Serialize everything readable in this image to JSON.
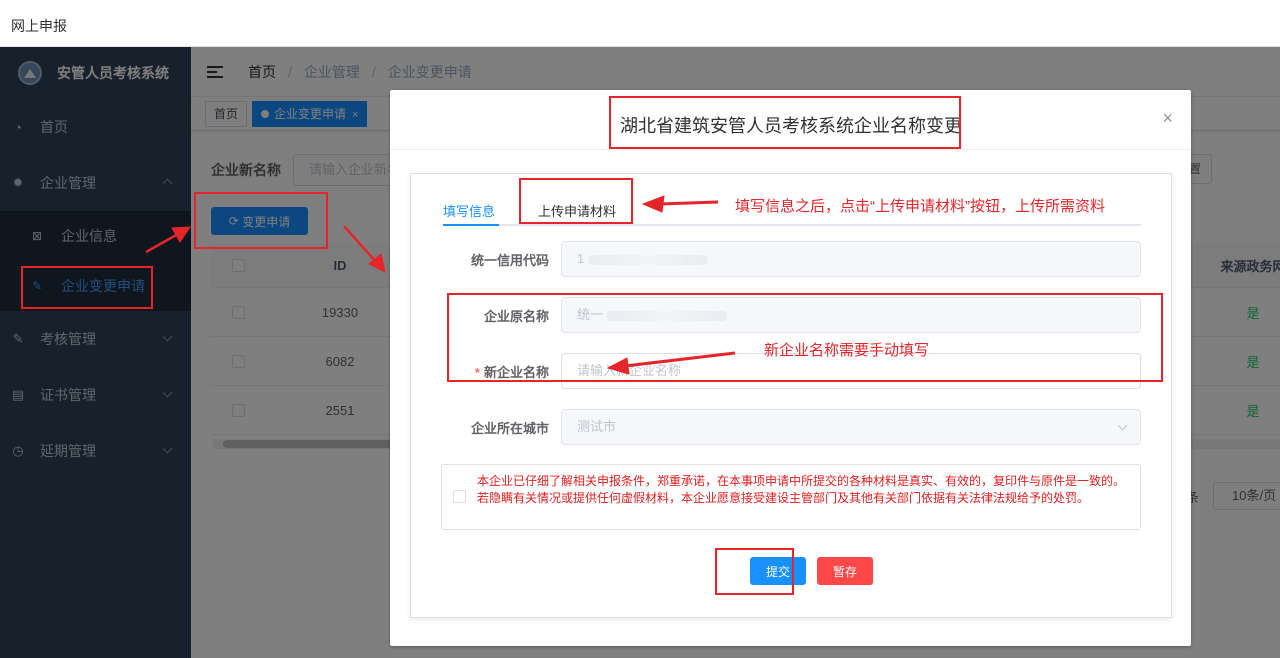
{
  "window": {
    "title": "网上申报"
  },
  "sidebar": {
    "app_name": "安管人员考核系统",
    "items": [
      {
        "label": "首页",
        "icon": "dashboard-icon"
      },
      {
        "label": "企业管理",
        "icon": "gear-icon",
        "expanded": true,
        "children": [
          {
            "label": "企业信息",
            "icon": "id-card-icon"
          },
          {
            "label": "企业变更申请",
            "icon": "edit-icon",
            "active": true
          }
        ]
      },
      {
        "label": "考核管理",
        "icon": "edit-icon"
      },
      {
        "label": "证书管理",
        "icon": "certificate-icon"
      },
      {
        "label": "延期管理",
        "icon": "clock-icon"
      }
    ]
  },
  "navbar": {
    "breadcrumb": [
      "首页",
      "企业管理",
      "企业变更申请"
    ]
  },
  "tags": [
    {
      "label": "首页"
    },
    {
      "label": "企业变更申请",
      "close": "×"
    }
  ],
  "search": {
    "label": "企业新名称",
    "placeholder": "请输入企业新名",
    "right_button": "置"
  },
  "toolbar": {
    "change_button": "变更申请"
  },
  "table": {
    "headers": {
      "id": "ID",
      "source": "来源政务网"
    },
    "rows": [
      {
        "id": "19330",
        "source": "是"
      },
      {
        "id": "6082",
        "source": "是"
      },
      {
        "id": "2551",
        "source": "是"
      }
    ]
  },
  "pager": {
    "suffix": "条",
    "page_size": "10条/页"
  },
  "dialog": {
    "title": "湖北省建筑安管人员考核系统企业名称变更",
    "close": "×",
    "tabs": [
      "填写信息",
      "上传申请材料"
    ],
    "fields": {
      "credit_code": {
        "label": "统一信用代码",
        "value": "1"
      },
      "old_name": {
        "label": "企业原名称",
        "value": "统一"
      },
      "new_name": {
        "label": "新企业名称",
        "required": "*",
        "placeholder": "请输入新企业名称"
      },
      "city": {
        "label": "企业所在城市",
        "value": "测试市"
      }
    },
    "notice": "本企业已仔细了解相关申报条件，郑重承诺，在本事项申请中所提交的各种材料是真实、有效的，复印件与原件是一致的。 若隐瞒有关情况或提供任何虚假材料，本企业愿意接受建设主管部门及其他有关部门依据有关法律法规给予的处罚。",
    "buttons": {
      "submit": "提交",
      "save": "暂存"
    }
  },
  "annotations": {
    "upload_hint": "填写信息之后，点击“上传申请材料”按钮，上传所需资料",
    "name_hint": "新企业名称需要手动填写",
    "color": "#e5252a"
  }
}
